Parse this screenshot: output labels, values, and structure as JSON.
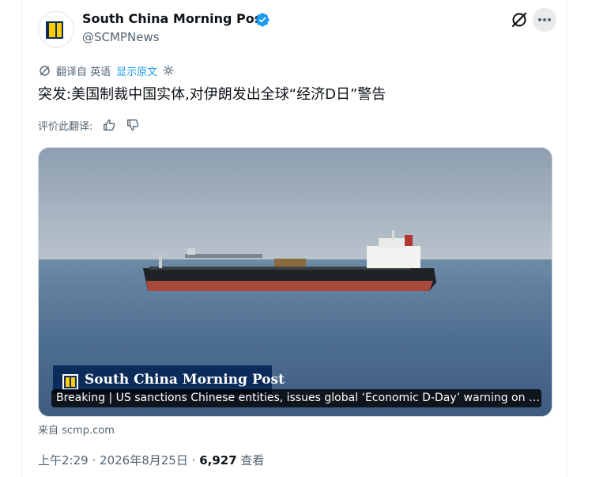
{
  "author": {
    "name": "South China Morning Post",
    "handle": "@SCMPNews",
    "verified_color": "#1d9bf0"
  },
  "actions": {
    "grok_icon": "grok-icon",
    "more_icon": "more-icon"
  },
  "translation": {
    "prefix": "翻译自 英语",
    "show_original": "显示原文",
    "icon": "translate-icon",
    "settings_icon": "gear-icon",
    "rate_label": "评价此翻译:"
  },
  "tweet": {
    "text": "突发:美国制裁中国实体,对伊朗发出全球“经济D日”警告"
  },
  "media": {
    "brand_text": "South China Morning Post",
    "caption": "Breaking | US sanctions Chinese entities, issues global ‘Economic D-Day’ warning on Ir..."
  },
  "link_source": "来自 scmp.com",
  "meta": {
    "time": "上午2:29",
    "date": "2026年8月25日",
    "separator": "·",
    "views": "6,927",
    "views_label": "查看"
  },
  "colors": {
    "accent": "#1d9bf0",
    "secondary_text": "#536471",
    "primary_text": "#0f1419"
  }
}
